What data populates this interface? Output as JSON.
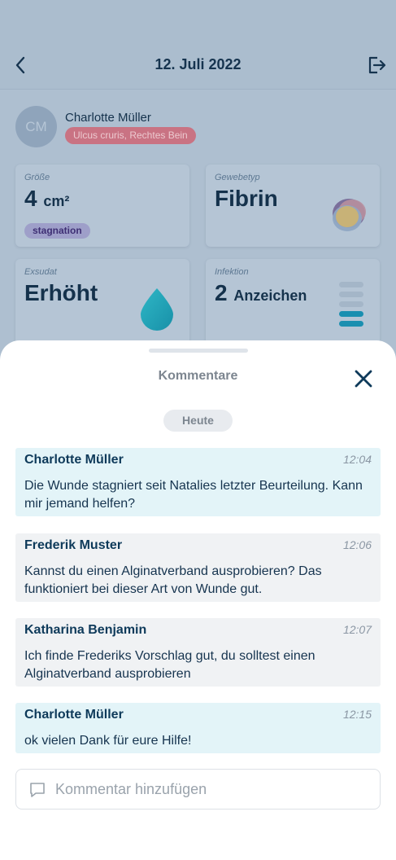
{
  "header": {
    "date_title": "12. Juli 2022",
    "back_icon": "chevron-left-icon",
    "export_icon": "export-icon"
  },
  "patient": {
    "initials": "CM",
    "name": "Charlotte Müller",
    "diagnosis": "Ulcus cruris, Rechtes Bein"
  },
  "cards": {
    "size": {
      "label": "Größe",
      "value": "4",
      "unit": "cm²",
      "status": "stagnation"
    },
    "tissue": {
      "label": "Gewebetyp",
      "value": "Fibrin",
      "icon": "tissue-blob-icon"
    },
    "exudate": {
      "label": "Exsudat",
      "value": "Erhöht",
      "icon": "droplet-icon"
    },
    "infection": {
      "label": "Infektion",
      "value": "2",
      "unit": "Anzeichen",
      "level": 2,
      "max_level": 5,
      "icon": "level-bars-icon"
    }
  },
  "sheet": {
    "title": "Kommentare",
    "close_icon": "close-icon",
    "day_label": "Heute",
    "comments": [
      {
        "author": "Charlotte Müller",
        "time": "12:04",
        "text": "Die Wunde stagniert seit Natalies letzter Beurteilung. Kann mir jemand helfen?"
      },
      {
        "author": "Frederik Muster",
        "time": "12:06",
        "text": "Kannst du einen Alginatverband ausprobieren? Das funktioniert bei dieser Art von Wunde gut."
      },
      {
        "author": "Katharina Benjamin",
        "time": "12:07",
        "text": "Ich finde Frederiks Vorschlag gut, du solltest einen Alginatverband ausprobieren"
      },
      {
        "author": "Charlotte Müller",
        "time": "12:15",
        "text": "ok vielen Dank für eure  Hilfe!"
      }
    ],
    "input": {
      "placeholder": "Kommentar hinzufügen",
      "value": "",
      "icon": "comment-icon"
    }
  },
  "colors": {
    "accent": "#0e3a5a",
    "own_comment_bg": "#e3f4f8",
    "other_comment_bg": "#f0f2f4",
    "diagnosis_badge": "#c97383",
    "stagnation_badge": "#9e9fc9",
    "droplet": "#1aa3b8"
  }
}
